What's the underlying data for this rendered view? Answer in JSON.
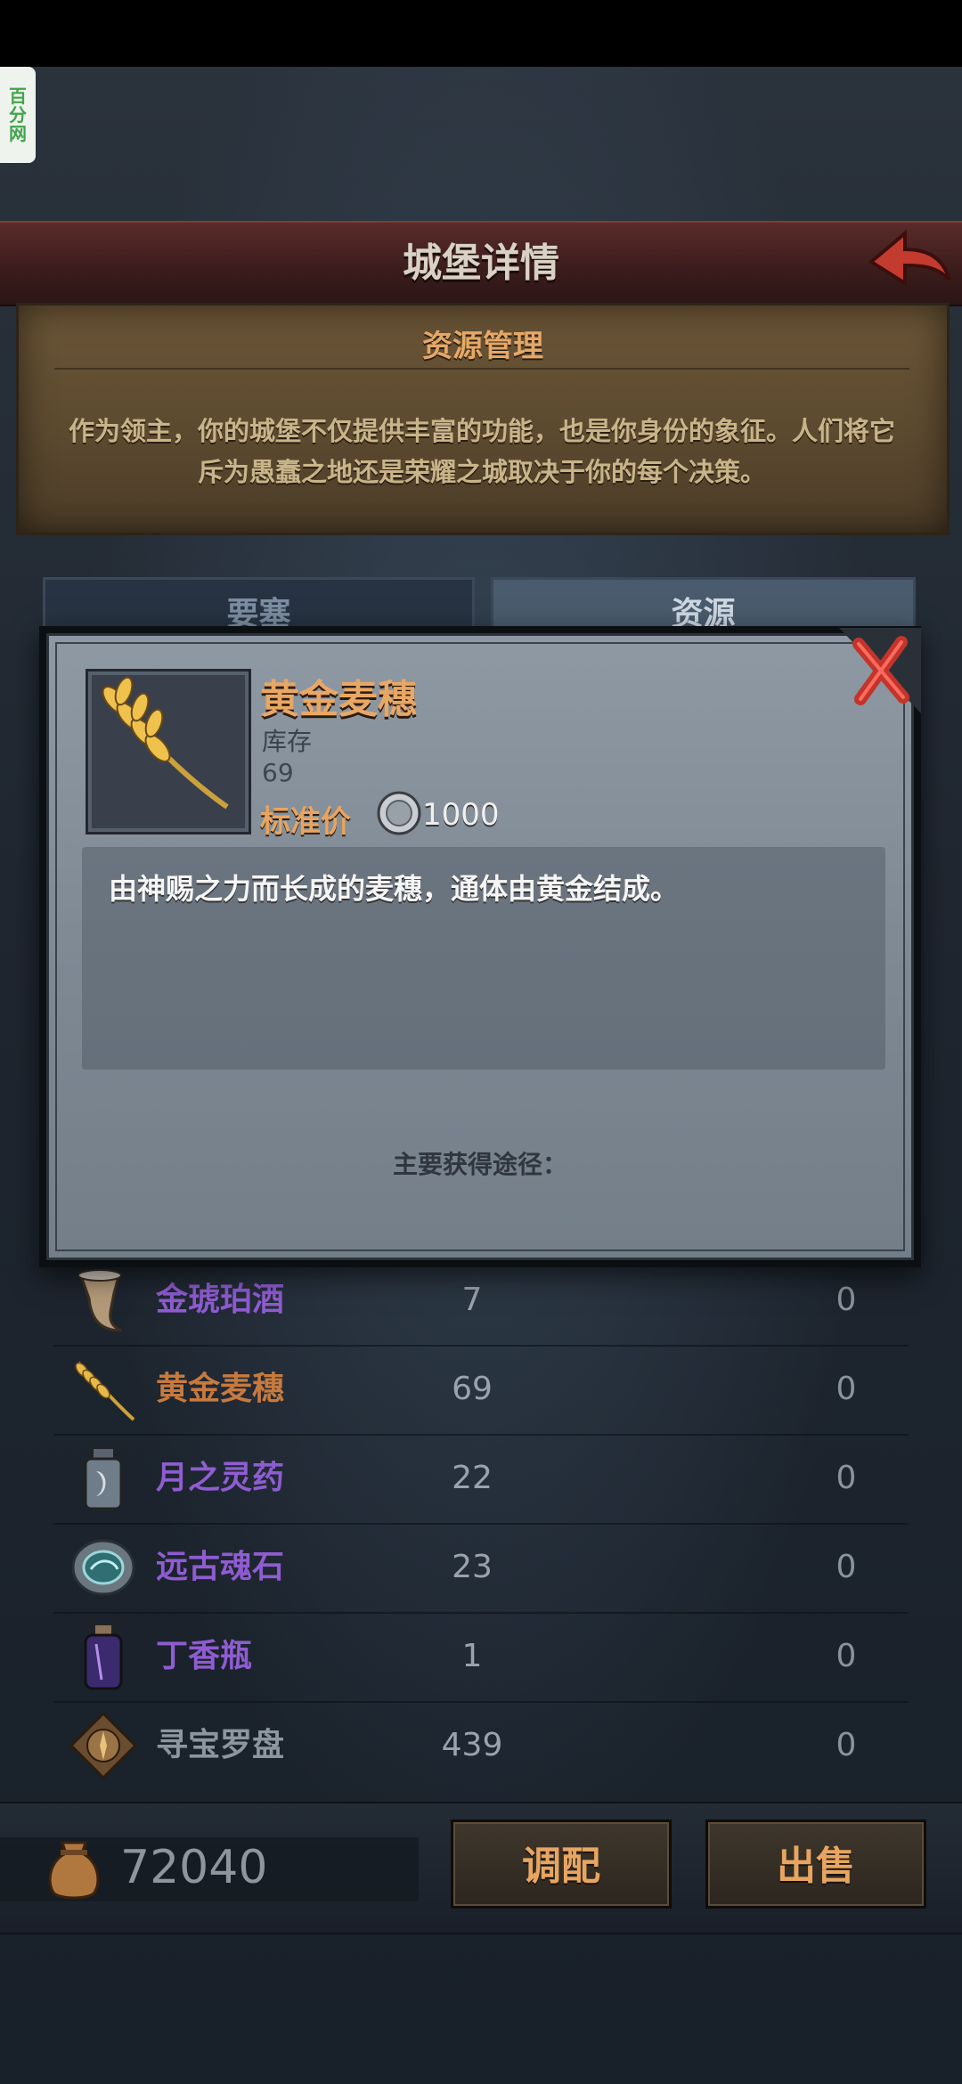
{
  "watermark": [
    "百",
    "分",
    "网"
  ],
  "header": {
    "title": "城堡详情"
  },
  "parchment": {
    "title": "资源管理",
    "description": "作为领主，你的城堡不仅提供丰富的功能，也是你身份的象征。人们将它斥为愚蠢之地还是荣耀之城取决于你的每个决策。"
  },
  "tabs": [
    {
      "label": "要塞",
      "active": false
    },
    {
      "label": "资源",
      "active": true
    }
  ],
  "resources": [
    {
      "name": "金琥珀酒",
      "stock": "7",
      "extra": "0",
      "color": "#8f5cd1",
      "icon": "horn-cup-icon"
    },
    {
      "name": "黄金麦穗",
      "stock": "69",
      "extra": "0",
      "color": "#c77a3e",
      "icon": "golden-wheat-icon"
    },
    {
      "name": "月之灵药",
      "stock": "22",
      "extra": "0",
      "color": "#8f5cd1",
      "icon": "moon-elixir-icon"
    },
    {
      "name": "远古魂石",
      "stock": "23",
      "extra": "0",
      "color": "#8f5cd1",
      "icon": "soul-stone-icon"
    },
    {
      "name": "丁香瓶",
      "stock": "1",
      "extra": "0",
      "color": "#8f5cd1",
      "icon": "clove-bottle-icon"
    },
    {
      "name": "寻宝罗盘",
      "stock": "439",
      "extra": "0",
      "color": "#8d959e",
      "icon": "treasure-compass-icon"
    }
  ],
  "footer": {
    "gold": "72040",
    "allocate_label": "调配",
    "sell_label": "出售"
  },
  "modal": {
    "item_name": "黄金麦穗",
    "stock_label": "库存",
    "stock_value": "69",
    "price_label": "标准价",
    "price_value": "1000",
    "description": "由神赐之力而长成的麦穗，通体由黄金结成。",
    "obtain_label": "主要获得途径："
  }
}
